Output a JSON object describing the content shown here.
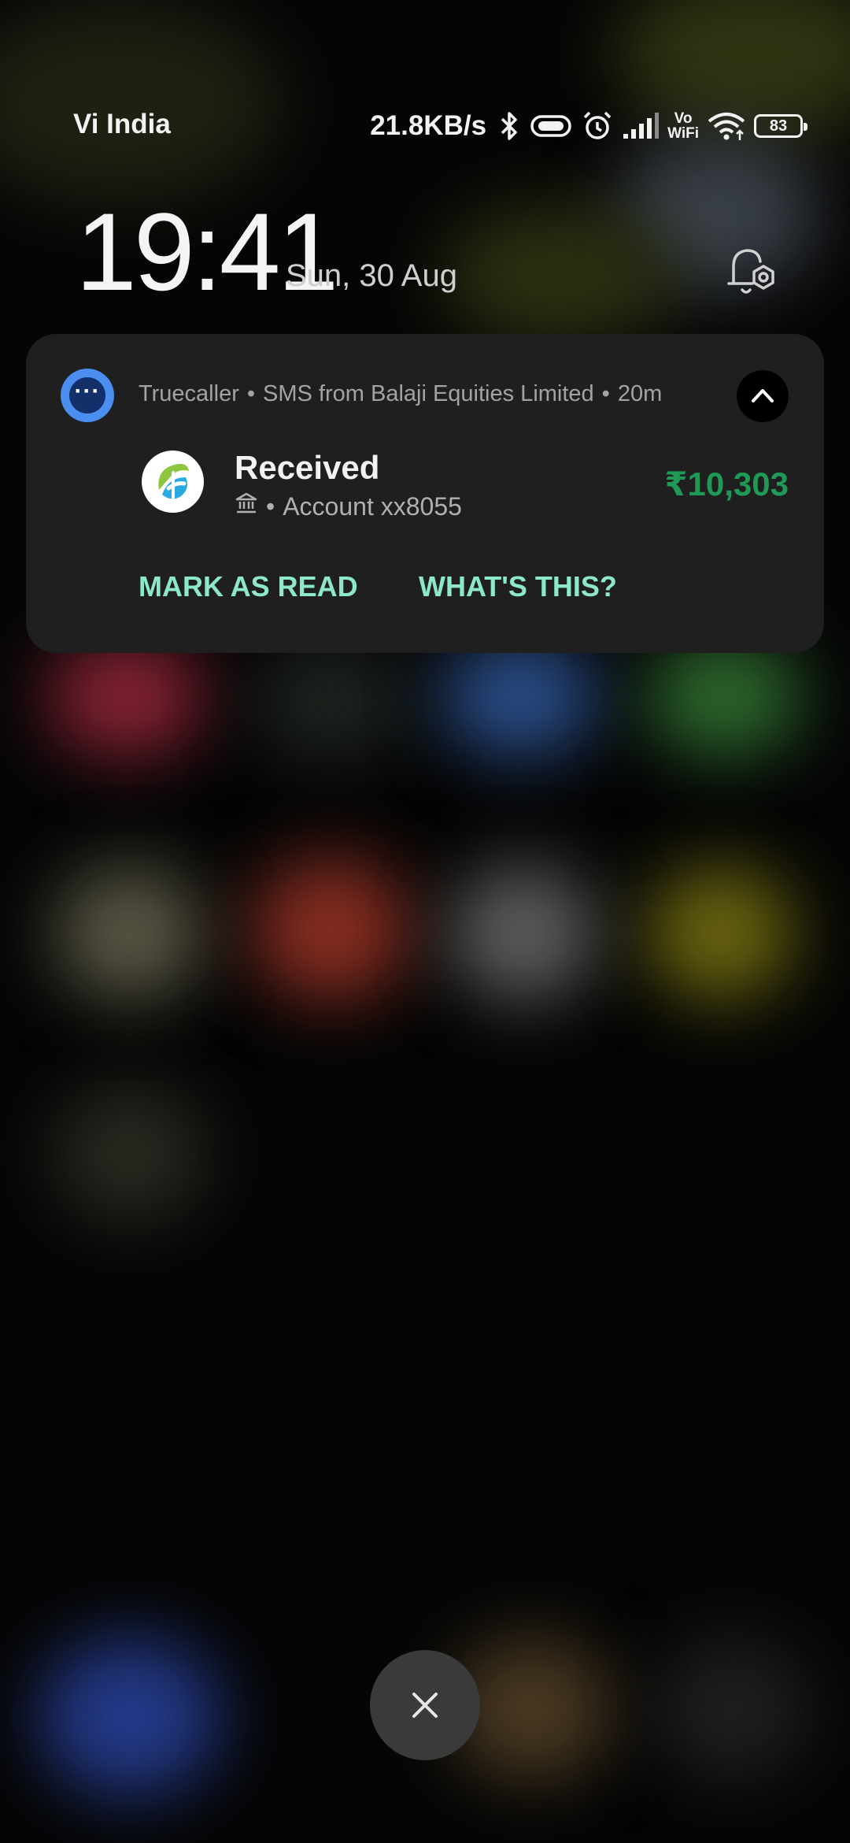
{
  "status_bar": {
    "carrier": "Vi India",
    "net_speed": "21.8KB/s",
    "vowifi_top": "Vo",
    "vowifi_bottom": "WiFi",
    "battery": "83",
    "icons": [
      "bluetooth-icon",
      "vibrate-icon",
      "alarm-icon",
      "signal-icon",
      "vowifi-icon",
      "wifi-icon",
      "battery-icon"
    ]
  },
  "lockscreen": {
    "time": "19:41",
    "date": "Sun, 30 Aug"
  },
  "notification": {
    "app_name": "Truecaller",
    "separator": "•",
    "source": "SMS from Balaji Equities Limited",
    "age": "20m",
    "title": "Received",
    "detail_separator": "•",
    "account": "Account xx8055",
    "amount": "₹10,303",
    "actions": [
      "MARK AS READ",
      "WHAT'S THIS?"
    ],
    "app_icon_text": "···"
  },
  "colors": {
    "amount": "#1f9a56",
    "action_text": "#8ce8c8",
    "app_icon_ring": "#4a8ef0",
    "card_background": "#1f1f1f"
  }
}
